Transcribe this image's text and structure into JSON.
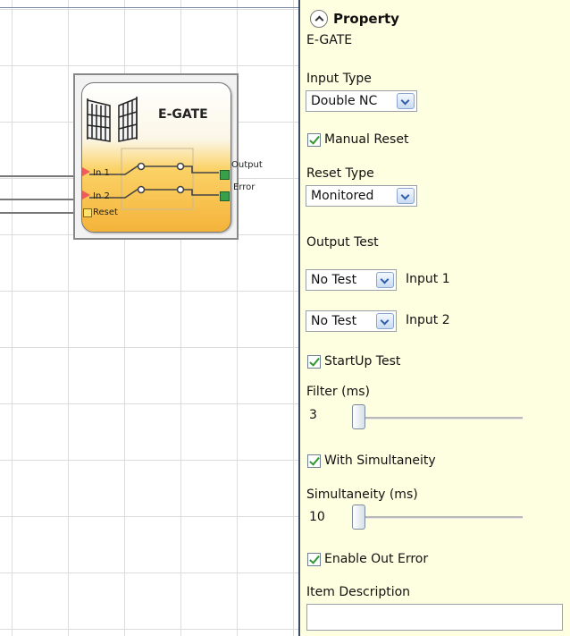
{
  "diagram": {
    "block": {
      "title": "E-GATE",
      "inputs": [
        "In 1",
        "In 2",
        "Reset"
      ],
      "outputs": [
        "Output",
        "Error"
      ]
    }
  },
  "property": {
    "header": "Property",
    "item_name": "E-GATE",
    "input_type": {
      "label": "Input Type",
      "value": "Double NC"
    },
    "manual_reset": {
      "label": "Manual Reset",
      "checked": true
    },
    "reset_type": {
      "label": "Reset Type",
      "value": "Monitored"
    },
    "output_test": {
      "label": "Output Test",
      "rows": [
        {
          "value": "No Test",
          "input_label": "Input 1"
        },
        {
          "value": "No Test",
          "input_label": "Input 2"
        }
      ]
    },
    "startup_test": {
      "label": "StartUp Test",
      "checked": true
    },
    "filter": {
      "label": "Filter (ms)",
      "value": "3"
    },
    "with_simultaneity": {
      "label": "With Simultaneity",
      "checked": true
    },
    "simultaneity": {
      "label": "Simultaneity (ms)",
      "value": "10"
    },
    "enable_out_error": {
      "label": "Enable Out Error",
      "checked": true
    },
    "item_description": {
      "label": "Item Description",
      "value": ""
    }
  },
  "colors": {
    "panel_bg": "#fefee0",
    "block_gradient_bottom": "#f4b33a",
    "input_port": "#ef5a5a",
    "output_port": "#39a04a",
    "reset_port": "#ffe26b"
  },
  "icons": [
    "gate-icon",
    "collapse-up-icon",
    "chevron-down-icon",
    "checkmark-icon"
  ]
}
